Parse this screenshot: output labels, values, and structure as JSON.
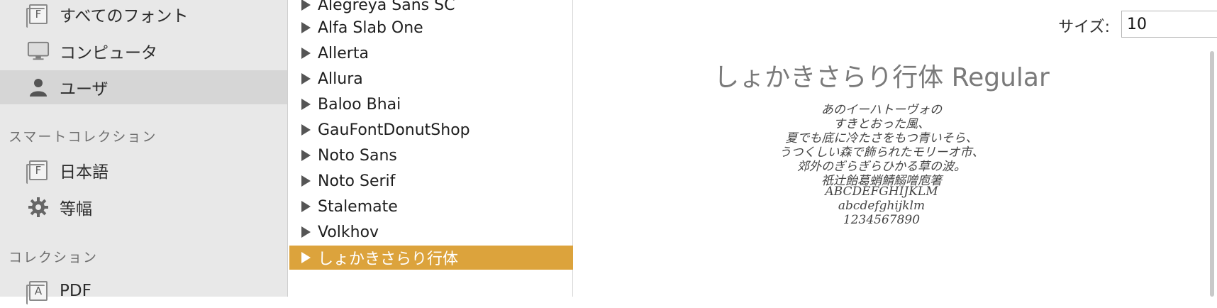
{
  "sidebar": {
    "items": [
      {
        "label": "すべてのフォント",
        "icon": "font-collection-icon"
      },
      {
        "label": "コンピュータ",
        "icon": "computer-icon"
      },
      {
        "label": "ユーザ",
        "icon": "user-icon"
      }
    ],
    "smart_collection_title": "スマートコレクション",
    "smart_items": [
      {
        "label": "日本語",
        "icon": "font-collection-icon"
      },
      {
        "label": "等幅",
        "icon": "gear-icon"
      }
    ],
    "collection_title": "コレクション",
    "collection_items": [
      {
        "label": "PDF",
        "icon": "font-collection-icon"
      }
    ],
    "icon_glyph_f": "F",
    "icon_glyph_a": "A"
  },
  "font_list": {
    "items": [
      "Alegreya Sans SC",
      "Alfa Slab One",
      "Allerta",
      "Allura",
      "Baloo Bhai",
      "GauFontDonutShop",
      "Noto Sans",
      "Noto Serif",
      "Stalemate",
      "Volkhov",
      "しょかきさらり行体"
    ],
    "selected_index": 10
  },
  "preview": {
    "size_label": "サイズ:",
    "size_value": "10",
    "title": "しょかきさらり行体 Regular",
    "sample_lines": [
      "あのイーハトーヴォの",
      "すきとおった風、",
      "夏でも底に冷たさをもつ青いそら、",
      "うつくしい森で飾られたモリーオ市、",
      "郊外のぎらぎらひかる草の波。",
      "祇辻飴葛蛸鯖鰯噌庖箸",
      "ABCDEFGHIJKLM",
      "abcdefghijklm",
      "1234567890"
    ]
  },
  "colors": {
    "accent": "#dca33c",
    "sidebar_bg": "#e8e8e8",
    "sidebar_selected": "#d6d6d6"
  }
}
